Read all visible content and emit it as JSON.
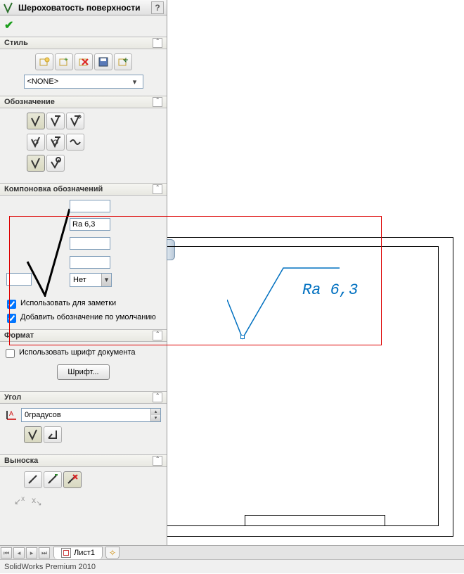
{
  "panel": {
    "title": "Шероховатость поверхности",
    "help": "?"
  },
  "sections": {
    "style": {
      "title": "Стиль",
      "combo_value": "<NONE>"
    },
    "symbol": {
      "title": "Обозначение"
    },
    "layout": {
      "title": "Компоновка обозначений",
      "ra_value": "Ra 6,3",
      "lay_none": "Нет",
      "use_for_notes": "Использовать для заметки",
      "add_default": "Добавить обозначение по умолчанию"
    },
    "format": {
      "title": "Формат",
      "use_doc_font": "Использовать шрифт документа",
      "font_btn": "Шрифт..."
    },
    "angle": {
      "title": "Угол",
      "value": "0градусов"
    },
    "leader": {
      "title": "Выноска"
    }
  },
  "canvas": {
    "sf_text": "Ra 6,3"
  },
  "tabs": {
    "sheet1": "Лист1"
  },
  "status": "SolidWorks Premium 2010"
}
